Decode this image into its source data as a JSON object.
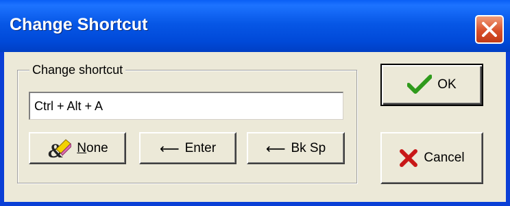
{
  "window": {
    "title": "Change Shortcut"
  },
  "group": {
    "label": "Change shortcut"
  },
  "shortcut_input": {
    "value": "Ctrl + Alt + A"
  },
  "buttons": {
    "none": {
      "label": "None",
      "mnemonic": "N",
      "rest": "one",
      "icon": "eraser-icon"
    },
    "enter": {
      "label": "Enter",
      "glyph": "⟵"
    },
    "backspace": {
      "label": "Bk Sp",
      "glyph": "⟵"
    },
    "ok": {
      "label": "OK",
      "icon": "checkmark-icon"
    },
    "cancel": {
      "label": "Cancel",
      "icon": "cross-icon"
    }
  },
  "colors": {
    "titlebar": "#0757e6",
    "dialog_bg": "#ece9d8",
    "close_button": "#d8502a",
    "ok_check": "#2f9a1c",
    "cancel_cross": "#c81818"
  }
}
